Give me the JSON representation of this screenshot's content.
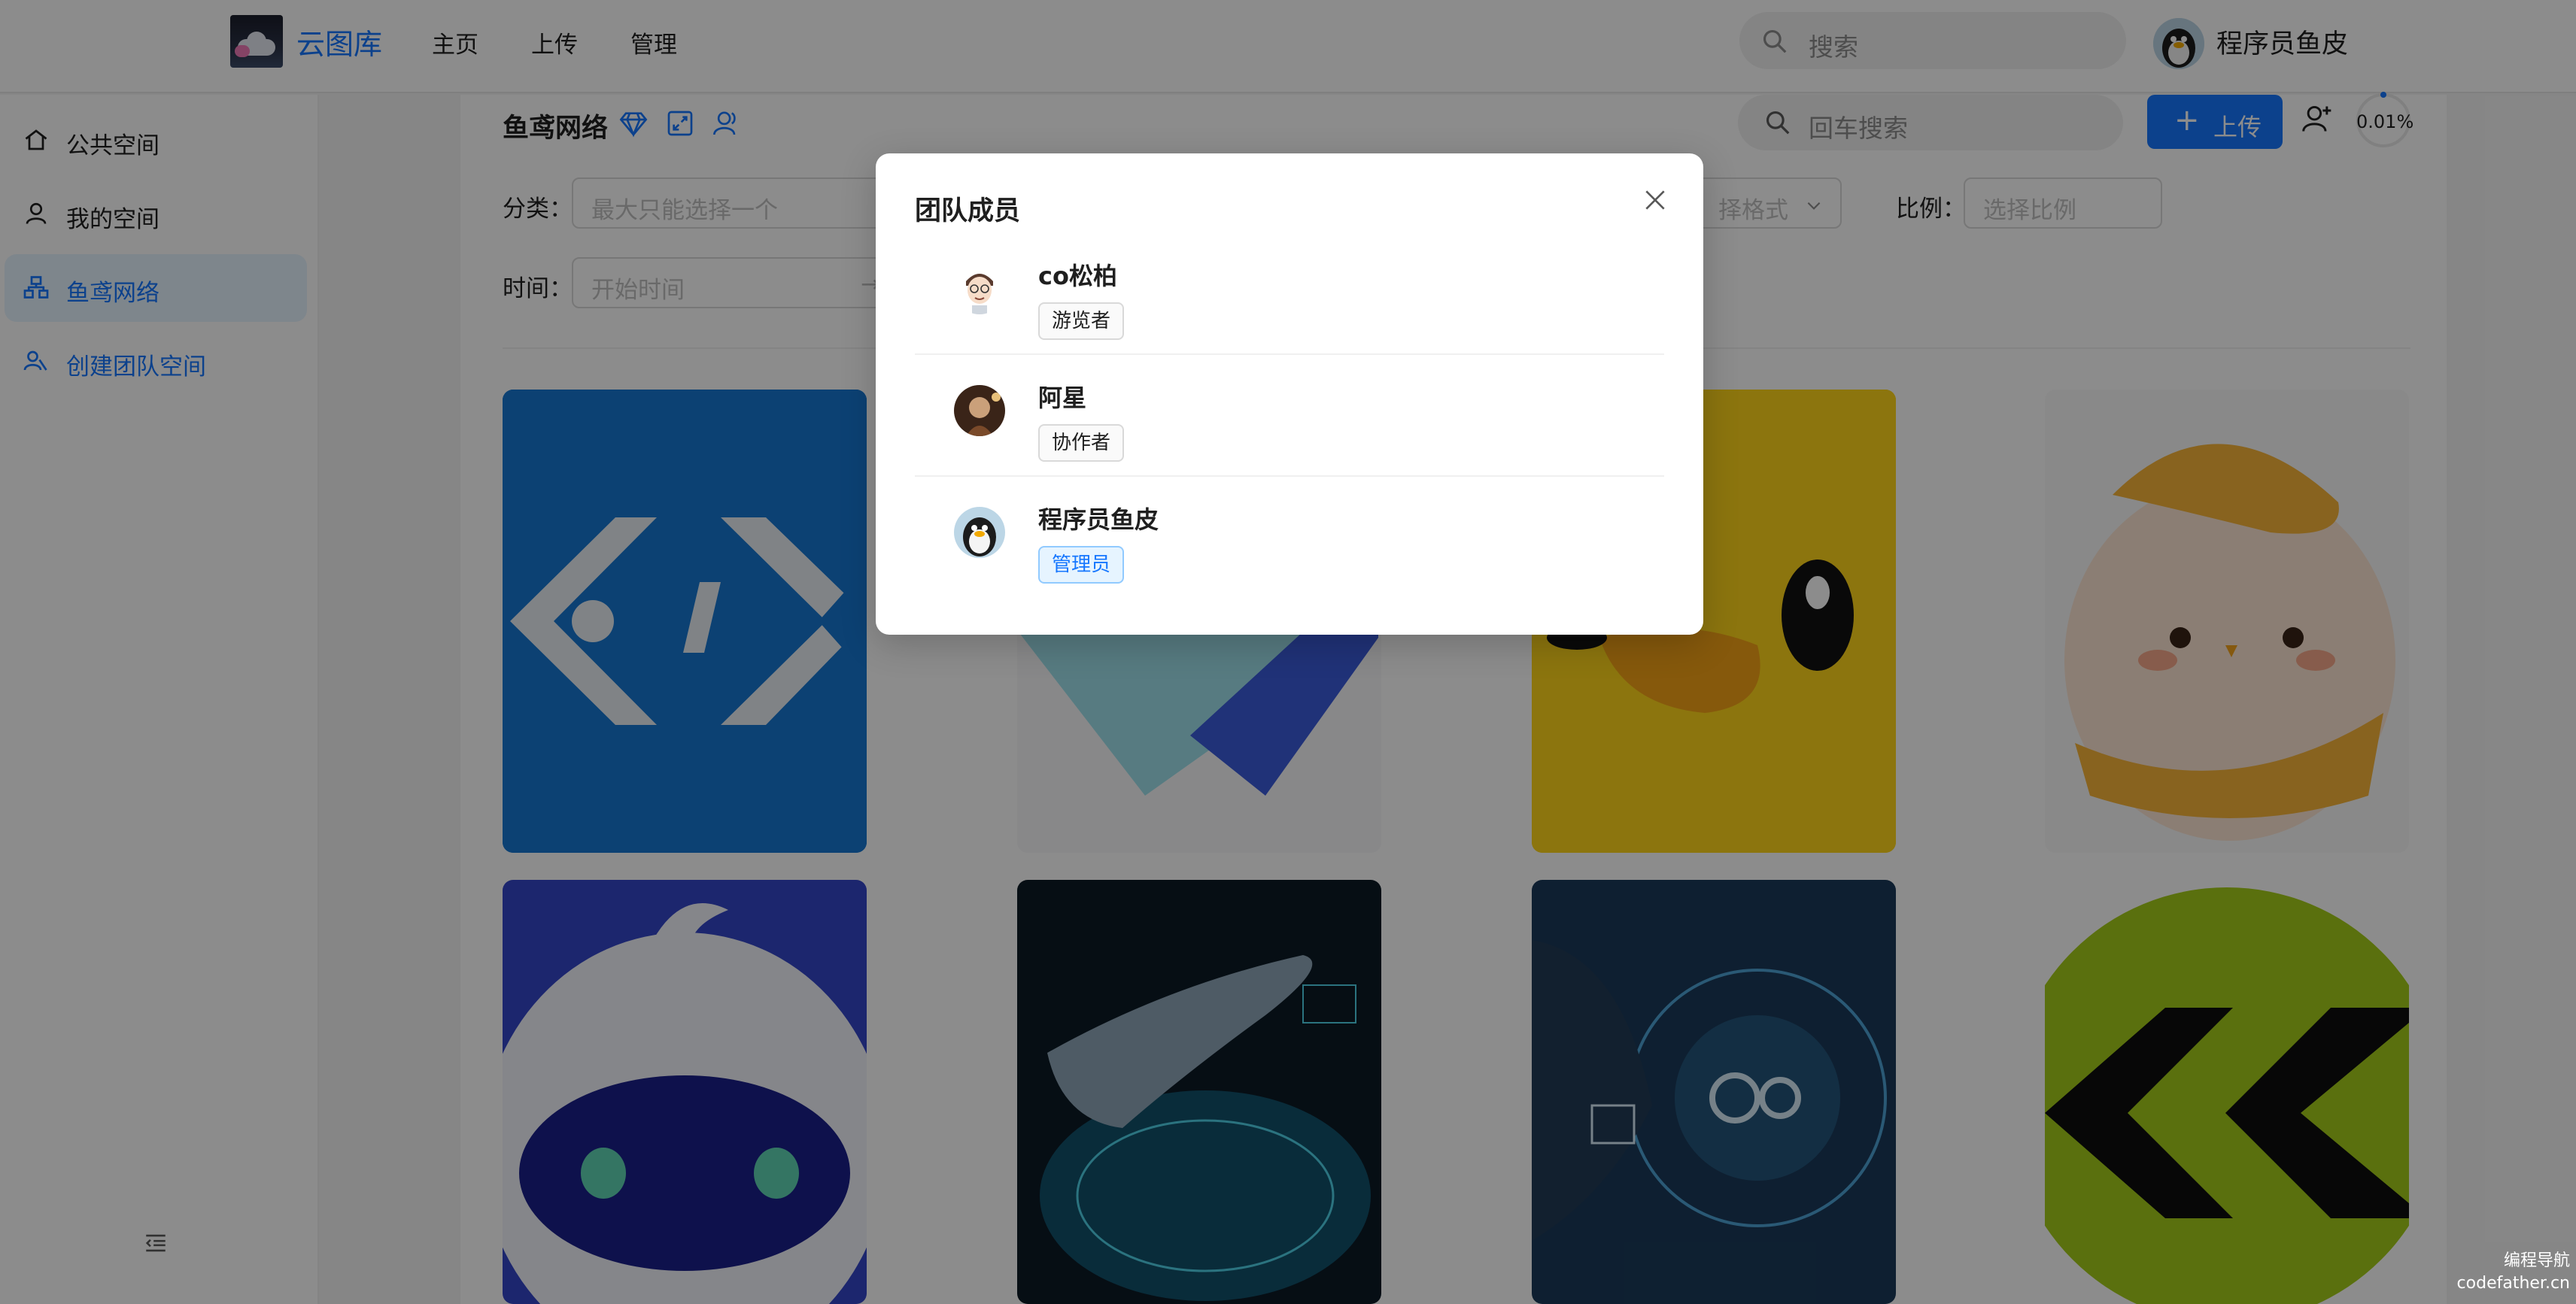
{
  "header": {
    "site_title": "云图库",
    "nav": [
      "主页",
      "上传",
      "管理"
    ],
    "search_placeholder": "搜索",
    "user_name": "程序员鱼皮"
  },
  "sidebar": {
    "items": [
      {
        "label": "公共空间",
        "icon": "home-icon"
      },
      {
        "label": "我的空间",
        "icon": "user-icon"
      },
      {
        "label": "鱼鸢网络",
        "icon": "team-icon"
      },
      {
        "label": "创建团队空间",
        "icon": "team-add-icon"
      }
    ]
  },
  "main": {
    "space_title": "鱼鸢网络",
    "search_placeholder": "回车搜索",
    "upload_label": "上传",
    "usage_percent": "0.01%",
    "filters": {
      "category_label": "分类：",
      "category_placeholder": "最大只能选择一个",
      "format_placeholder": "择格式",
      "ratio_label": "比例：",
      "ratio_placeholder": "选择比例",
      "time_label": "时间：",
      "time_start_placeholder": "开始时间"
    }
  },
  "modal": {
    "title": "团队成员",
    "members": [
      {
        "name": "co松柏",
        "role": "游览者"
      },
      {
        "name": "阿星",
        "role": "协作者"
      },
      {
        "name": "程序员鱼皮",
        "role": "管理员"
      }
    ]
  },
  "watermark": {
    "line1": "编程导航",
    "line2": "codefather.cn"
  },
  "colors": {
    "accent": "#1677ff",
    "active_bg": "#e6f4ff"
  }
}
